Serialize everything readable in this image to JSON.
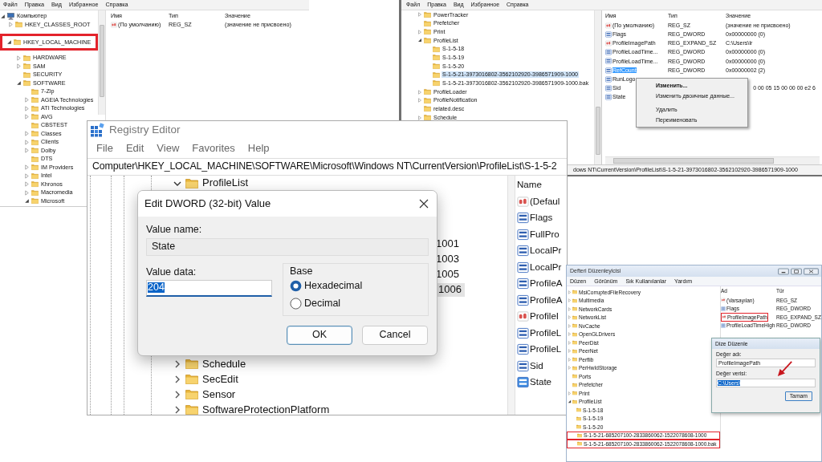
{
  "left_editor": {
    "menu": [
      "Файл",
      "Правка",
      "Вид",
      "Избранное",
      "Справка"
    ],
    "tree": [
      {
        "label": "Компьютер",
        "kind": "computer",
        "expanded": true,
        "children": [
          {
            "label": "HKEY_CLASSES_ROOT",
            "expanded": false,
            "highlighted": false
          },
          {
            "label": "HKEY_LOCAL_MACHINE",
            "expanded": true,
            "highlighted": true,
            "children": [
              {
                "label": "HARDWARE",
                "expanded": false
              },
              {
                "label": "SAM",
                "expanded": false
              },
              {
                "label": "SECURITY"
              },
              {
                "label": "SOFTWARE",
                "expanded": true,
                "children": [
                  {
                    "label": "7-Zip"
                  },
                  {
                    "label": "AGEIA Technologies",
                    "expanded": false
                  },
                  {
                    "label": "ATI Technologies",
                    "expanded": false
                  },
                  {
                    "label": "AVG",
                    "expanded": false
                  },
                  {
                    "label": "CBSTEST"
                  },
                  {
                    "label": "Classes",
                    "expanded": false
                  },
                  {
                    "label": "Clients",
                    "expanded": false
                  },
                  {
                    "label": "Dolby",
                    "expanded": false
                  },
                  {
                    "label": "DTS"
                  },
                  {
                    "label": "IM Providers",
                    "expanded": false
                  },
                  {
                    "label": "Intel",
                    "expanded": false
                  },
                  {
                    "label": "Khronos",
                    "expanded": false
                  },
                  {
                    "label": "Macromedia",
                    "expanded": false
                  },
                  {
                    "label": "Microsoft",
                    "expanded": true
                  }
                ]
              }
            ]
          }
        ]
      }
    ],
    "columns": [
      "Имя",
      "Тип",
      "Значение"
    ],
    "rows": [
      {
        "kind": "string",
        "name": "(По умолчанию)",
        "type": "REG_SZ",
        "value": "(значение не присвоено)"
      }
    ]
  },
  "right_editor": {
    "menu": [
      "Файл",
      "Правка",
      "Вид",
      "Избранное",
      "Справка"
    ],
    "tree": [
      {
        "label": "PowerTracker",
        "expanded": false
      },
      {
        "label": "Prefetcher"
      },
      {
        "label": "Print",
        "expanded": false
      },
      {
        "label": "ProfileList",
        "expanded": true,
        "children": [
          {
            "label": "S-1-5-18",
            "selected": false
          },
          {
            "label": "S-1-5-19",
            "selected": false
          },
          {
            "label": "S-1-5-20",
            "selected": false
          },
          {
            "label": "S-1-5-21-3973016802-3562102920-3986571909-1000",
            "selected": true
          },
          {
            "label": "S-1-5-21-3973016802-3562102920-3986571909-1000.bak",
            "selected": false
          }
        ]
      },
      {
        "label": "ProfileLoader",
        "expanded": false
      },
      {
        "label": "ProfileNotification",
        "expanded": false
      },
      {
        "label": "related.desc"
      },
      {
        "label": "Schedule",
        "expanded": false
      }
    ],
    "columns": [
      "Имя",
      "Тип",
      "Значение"
    ],
    "rows": [
      {
        "kind": "string",
        "name": "(По умолчанию)",
        "type": "REG_SZ",
        "value": "(значение не присвоено)",
        "selected": false
      },
      {
        "kind": "binary",
        "name": "Flags",
        "type": "REG_DWORD",
        "value": "0x00000000 (0)",
        "selected": false
      },
      {
        "kind": "string",
        "name": "ProfileImagePath",
        "type": "REG_EXPAND_SZ",
        "value": "C:\\Users\\Ir",
        "selected": false
      },
      {
        "kind": "binary",
        "name": "ProfileLoadTime...",
        "type": "REG_DWORD",
        "value": "0x00000000 (0)",
        "selected": false
      },
      {
        "kind": "binary",
        "name": "ProfileLoadTime...",
        "type": "REG_DWORD",
        "value": "0x00000000 (0)",
        "selected": false
      },
      {
        "kind": "binary",
        "name": "RefCount",
        "type": "REG_DWORD",
        "value": "0x00000002 (2)",
        "selected": true
      },
      {
        "kind": "binary",
        "name": "RunLogo",
        "selected": false
      },
      {
        "kind": "binary",
        "name": "Sid",
        "value": "0 00 05 15 00 00 00 e2 6",
        "cut": true,
        "selected": false
      },
      {
        "kind": "binary",
        "name": "State",
        "selected": false
      }
    ],
    "context_menu": [
      [
        {
          "label": "Изменить...",
          "default": true
        },
        {
          "label": "Изменить двоичные данные...",
          "default": false
        }
      ],
      [
        {
          "label": "Удалить",
          "default": false
        },
        {
          "label": "Переименовать",
          "default": false
        }
      ]
    ],
    "status_bar": "dows NT\\CurrentVersion\\ProfileList\\S-1-5-21-3973016802-3562102920-3986571909-1000"
  },
  "registry_editor": {
    "title": "Registry Editor",
    "menu": [
      "File",
      "Edit",
      "View",
      "Favorites",
      "Help"
    ],
    "address": "Computer\\HKEY_LOCAL_MACHINE\\SOFTWARE\\Microsoft\\Windows NT\\CurrentVersion\\ProfileList\\S-1-5-2",
    "tree": [
      {
        "label": "ProfileList",
        "expanded": true,
        "children": [
          {
            "label": "1001",
            "selected": false
          },
          {
            "label": "1003",
            "selected": false
          },
          {
            "label": "1005",
            "selected": false
          },
          {
            "label": "1006",
            "selected": true
          }
        ]
      },
      {
        "label": "Schedule",
        "expanded": false
      },
      {
        "label": "SecEdit",
        "expanded": false
      },
      {
        "label": "Sensor",
        "expanded": false
      },
      {
        "label": "SoftwareProtectionPlatform",
        "expanded": false
      }
    ],
    "columns": [
      "Name"
    ],
    "rows": [
      {
        "kind": "string",
        "name": "(Defaul",
        "selected": false
      },
      {
        "kind": "binary",
        "name": "Flags",
        "selected": false
      },
      {
        "kind": "binary",
        "name": "FullPro",
        "selected": false
      },
      {
        "kind": "binary",
        "name": "LocalPr",
        "selected": false
      },
      {
        "kind": "binary",
        "name": "LocalPr",
        "selected": false
      },
      {
        "kind": "binary",
        "name": "ProfileA",
        "selected": false
      },
      {
        "kind": "binary",
        "name": "ProfileA",
        "selected": false
      },
      {
        "kind": "string",
        "name": "ProfileI",
        "selected": false
      },
      {
        "kind": "binary",
        "name": "ProfileL",
        "selected": false
      },
      {
        "kind": "binary",
        "name": "ProfileL",
        "selected": false
      },
      {
        "kind": "binary",
        "name": "Sid",
        "selected": false
      },
      {
        "kind": "binary",
        "name": "State",
        "selected": true
      }
    ],
    "dialog": {
      "title": "Edit DWORD (32-bit) Value",
      "name_label": "Value name:",
      "name_value": "State",
      "data_label": "Value data:",
      "data_value": "204",
      "data_selected": true,
      "base_label": "Base",
      "radios": [
        {
          "label": "Hexadecimal",
          "selected": true
        },
        {
          "label": "Decimal",
          "selected": false
        }
      ],
      "buttons": [
        {
          "label": "OK",
          "default": true
        },
        {
          "label": "Cancel",
          "default": false
        }
      ]
    }
  },
  "turkish_editor": {
    "title": "Defteri Düzenleyicisi",
    "menu": [
      "Düzen",
      "Görünüm",
      "Sık Kullanılanlar",
      "Yardım"
    ],
    "tree": [
      {
        "label": "MsiCorruptedFileRecovery",
        "expanded": false
      },
      {
        "label": "Multimedia",
        "expanded": false
      },
      {
        "label": "NetworkCards",
        "expanded": false
      },
      {
        "label": "NetworkList",
        "expanded": false
      },
      {
        "label": "NvCache",
        "expanded": false
      },
      {
        "label": "OpenGLDrivers",
        "expanded": false
      },
      {
        "label": "PeerDist",
        "expanded": false
      },
      {
        "label": "PeerNet",
        "expanded": false
      },
      {
        "label": "Perflib",
        "expanded": false
      },
      {
        "label": "PerHwIdStorage",
        "expanded": false
      },
      {
        "label": "Ports"
      },
      {
        "label": "Prefetcher"
      },
      {
        "label": "Print",
        "expanded": false
      },
      {
        "label": "ProfileList",
        "expanded": true,
        "children": [
          {
            "label": "S-1-5-18",
            "highlighted": false
          },
          {
            "label": "S-1-5-19",
            "highlighted": false
          },
          {
            "label": "S-1-5-20",
            "highlighted": false
          },
          {
            "label": "S-1-5-21-685207100-2833860062-1522078608-1000",
            "highlighted": true
          },
          {
            "label": "S-1-5-21-685207100-2833860062-1522078608-1000.bak",
            "highlighted": true
          }
        ]
      }
    ],
    "columns": [
      "Ad",
      "Tür"
    ],
    "rows": [
      {
        "kind": "string",
        "name": "(Varsayılan)",
        "type": "REG_SZ",
        "highlighted": false
      },
      {
        "kind": "binary",
        "name": "Flags",
        "type": "REG_DWORD",
        "highlighted": false
      },
      {
        "kind": "string",
        "name": "ProfileImagePath",
        "type": "REG_EXPAND_SZ",
        "highlighted": true
      },
      {
        "kind": "binary",
        "name": "ProfileLoadTimeHigh",
        "type": "REG_DWORD",
        "highlighted": false
      }
    ],
    "dialog": {
      "title": "Dize Düzenle",
      "name_label": "Değer adı:",
      "name_value": "ProfileImagePath",
      "data_label": "Değer verisi:",
      "data_value": "C:\\Users\\",
      "data_selected": true,
      "buttons": [
        {
          "label": "Tamam",
          "default": true
        }
      ]
    }
  }
}
